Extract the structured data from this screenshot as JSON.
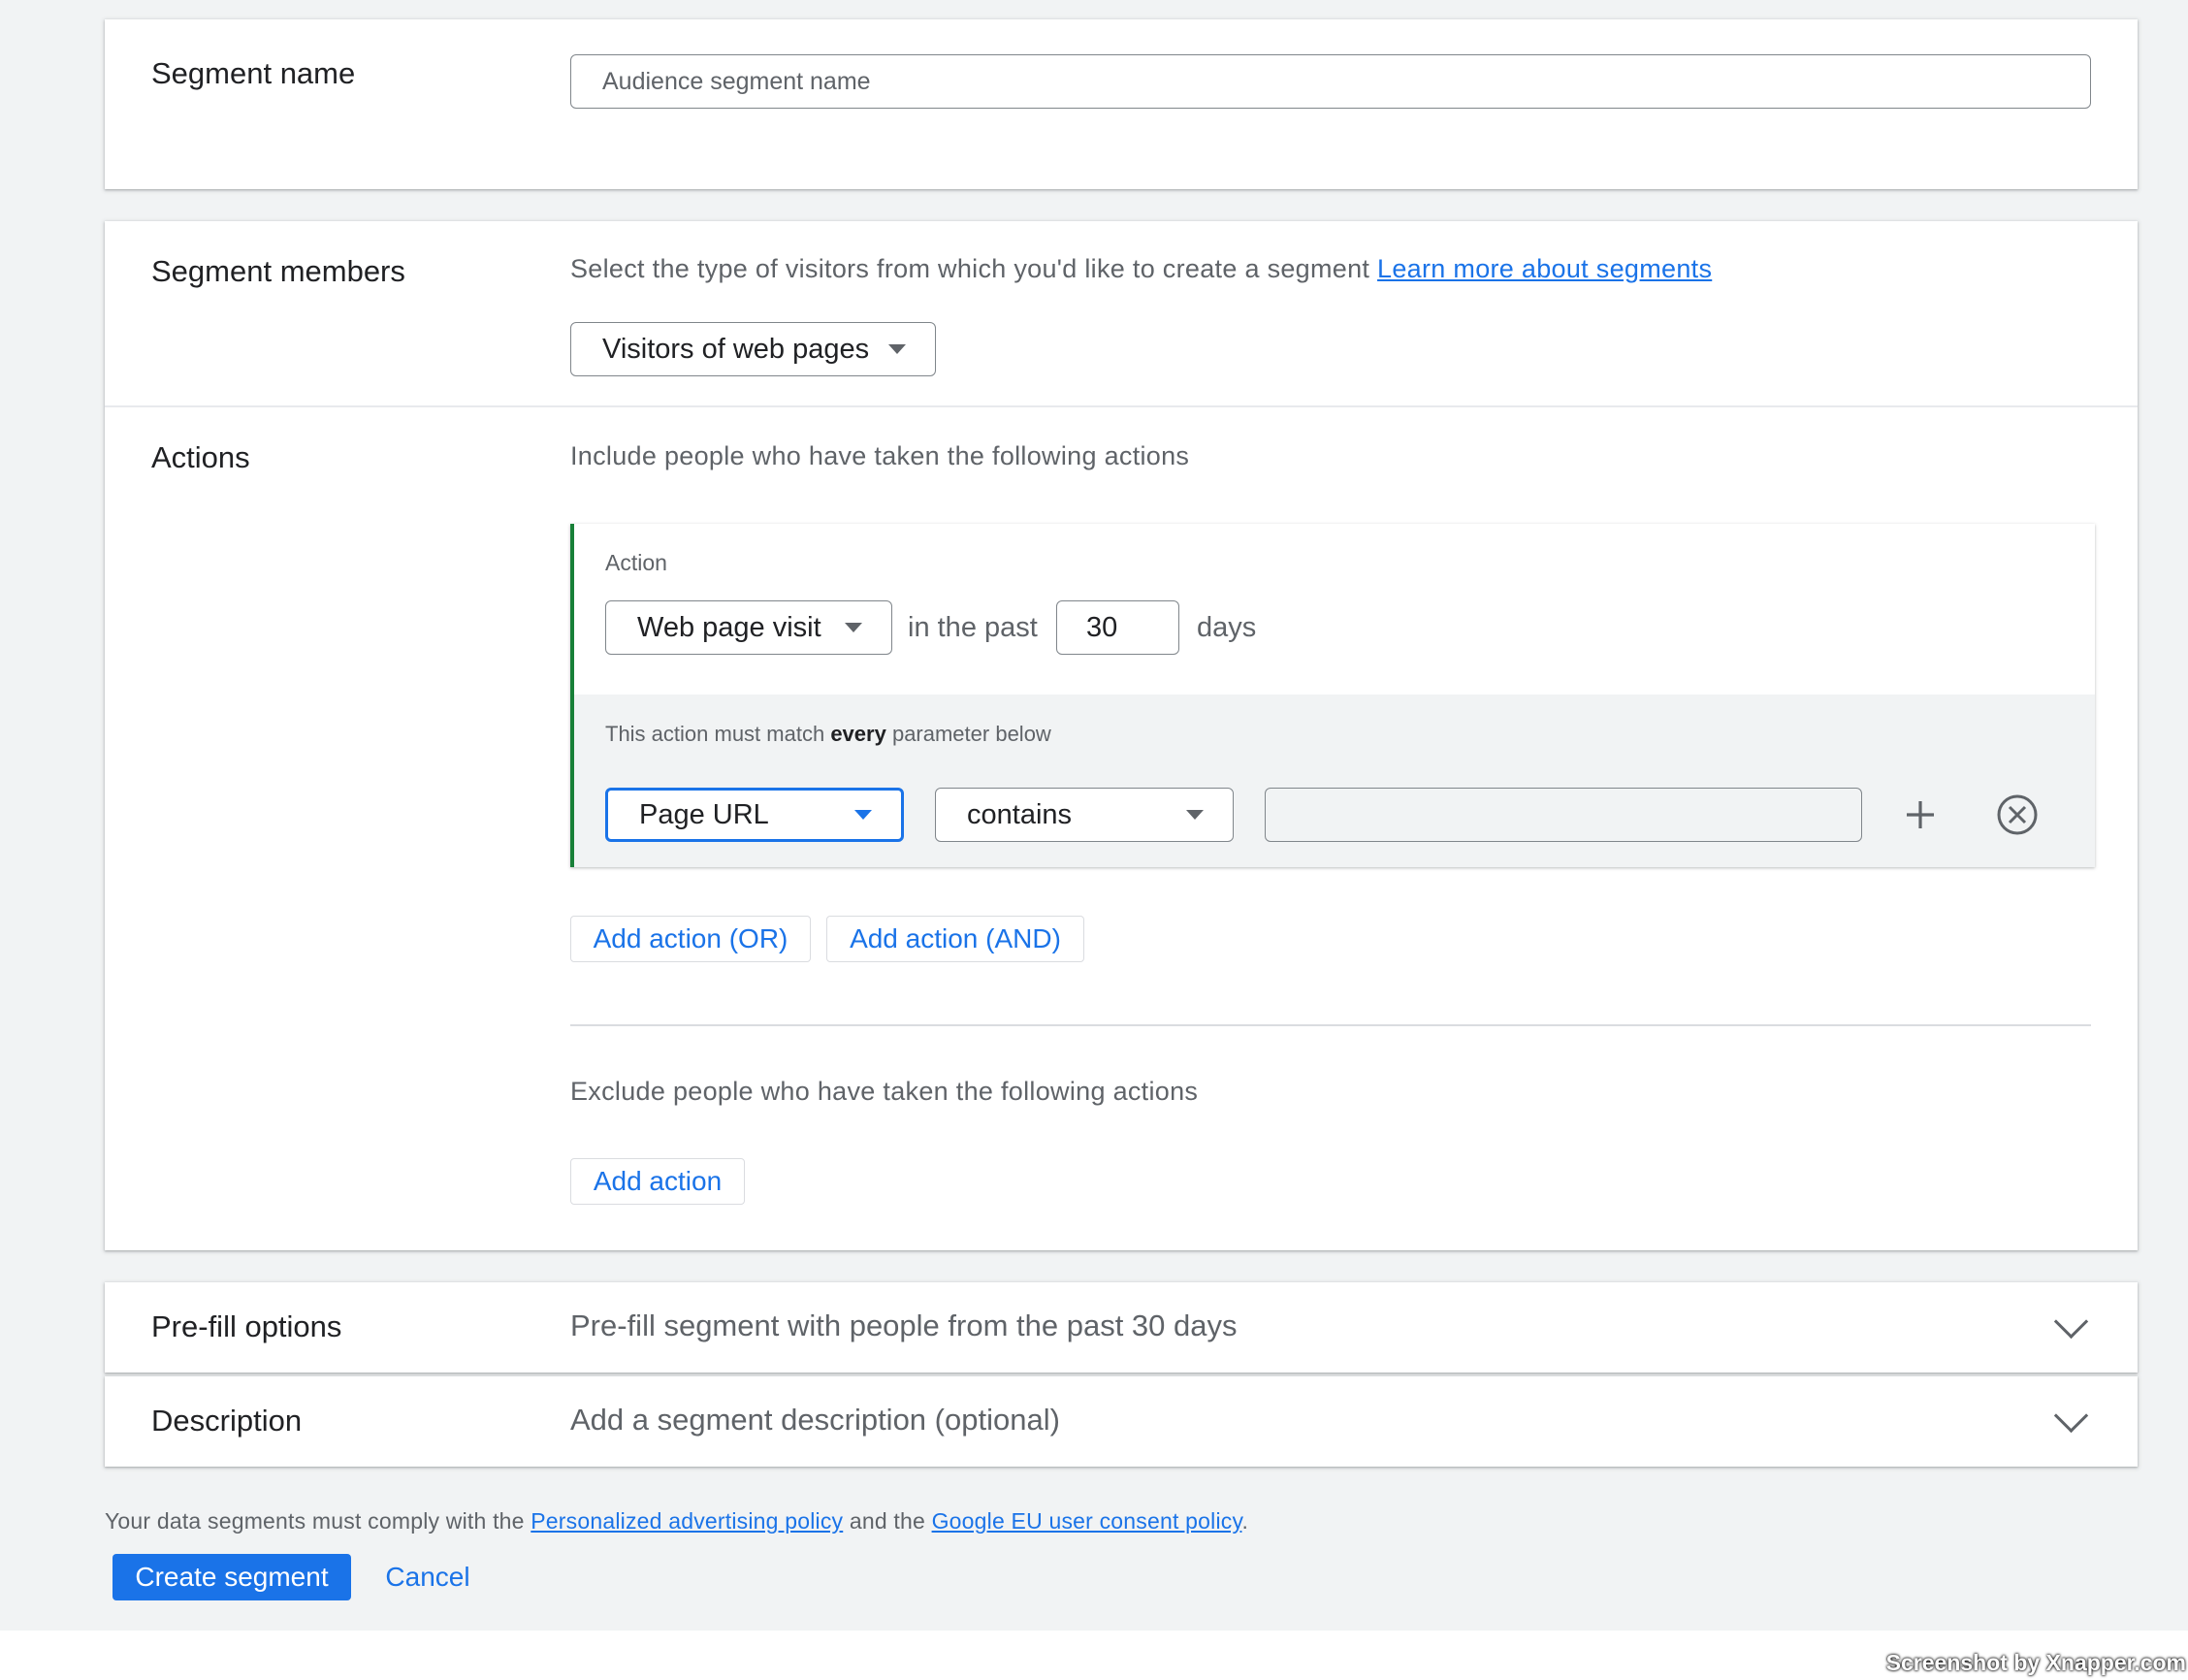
{
  "segment_name": {
    "title": "Segment name",
    "placeholder": "Audience segment name"
  },
  "segment_members": {
    "title": "Segment members",
    "description": "Select the type of visitors from which you'd like to create a segment",
    "learn_more_link": "Learn more about segments",
    "visitor_type_selected": "Visitors of web pages"
  },
  "actions": {
    "title": "Actions",
    "include_text": "Include people who have taken the following actions",
    "action_card": {
      "label": "Action",
      "action_type_selected": "Web page visit",
      "in_the_past_text": "in the past",
      "days_value": "30",
      "days_text": "days",
      "match_text_prefix": "This action must match",
      "match_text_bold": "every",
      "match_text_suffix": "parameter below",
      "parameter_selected": "Page URL",
      "operator_selected": "contains",
      "value_input": ""
    },
    "add_action_or_label": "Add action (OR)",
    "add_action_and_label": "Add action (AND)",
    "exclude_text": "Exclude people who have taken the following actions",
    "add_action_label": "Add action"
  },
  "prefill": {
    "title": "Pre-fill options",
    "summary": "Pre-fill segment with people from the past 30 days"
  },
  "description": {
    "title": "Description",
    "summary": "Add a segment description (optional)"
  },
  "footer": {
    "compliance_prefix": "Your data segments must comply with the",
    "policy_link_1": "Personalized advertising policy",
    "compliance_middle": "and the",
    "policy_link_2": "Google EU user consent policy",
    "compliance_suffix": ".",
    "create_button": "Create segment",
    "cancel_button": "Cancel"
  },
  "watermark": "Screenshot by Xnapper.com",
  "colors": {
    "primary_blue": "#1a73e8",
    "action_accent_green": "#188038",
    "page_background": "#f1f3f4"
  }
}
